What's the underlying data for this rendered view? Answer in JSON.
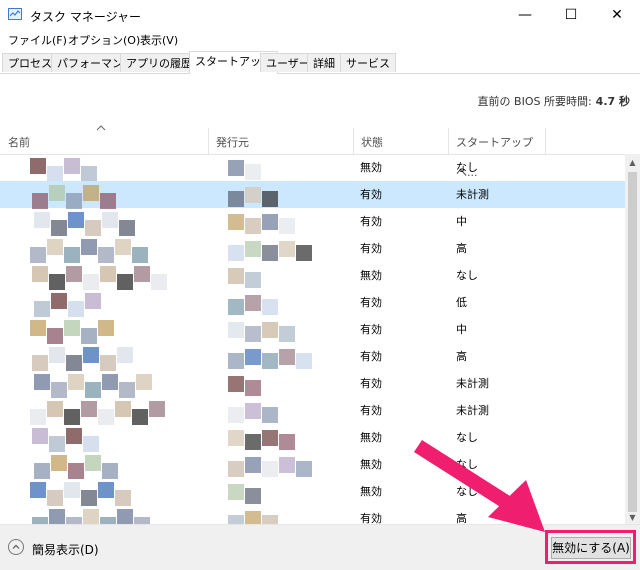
{
  "window": {
    "title": "タスク マネージャー",
    "minimize_glyph": "—",
    "maximize_glyph": "☐",
    "close_glyph": "✕",
    "icon": "task-manager-icon"
  },
  "menu": [
    "ファイル(F)",
    "オプション(O)",
    "表示(V)"
  ],
  "tabs": [
    "プロセス",
    "パフォーマンス",
    "アプリの履歴",
    "スタートアップ",
    "ユーザー",
    "詳細",
    "サービス"
  ],
  "active_tab": "スタートアップ",
  "bios": {
    "label": "直前の BIOS 所要時間:",
    "value": "4.7 秒"
  },
  "columns": {
    "name": "名前",
    "publisher": "発行元",
    "status": "状態",
    "impact": "スタートアップへ..."
  },
  "rows": [
    {
      "status": "無効",
      "impact": "なし"
    },
    {
      "status": "有効",
      "impact": "未計測"
    },
    {
      "status": "有効",
      "impact": "中"
    },
    {
      "status": "有効",
      "impact": "高"
    },
    {
      "status": "無効",
      "impact": "なし"
    },
    {
      "status": "有効",
      "impact": "低"
    },
    {
      "status": "有効",
      "impact": "中"
    },
    {
      "status": "有効",
      "impact": "高"
    },
    {
      "status": "有効",
      "impact": "未計測"
    },
    {
      "status": "有効",
      "impact": "未計測"
    },
    {
      "status": "無効",
      "impact": "なし"
    },
    {
      "status": "無効",
      "impact": "なし"
    },
    {
      "status": "無効",
      "impact": "なし"
    },
    {
      "status": "有効",
      "impact": "高"
    }
  ],
  "selected_row_index": 1,
  "footer": {
    "fewer_details": "簡易表示(D)",
    "disable_button": "無効にする(A)"
  },
  "colors": {
    "accent_highlight": "#f01e6e",
    "selection": "#cce8ff"
  }
}
